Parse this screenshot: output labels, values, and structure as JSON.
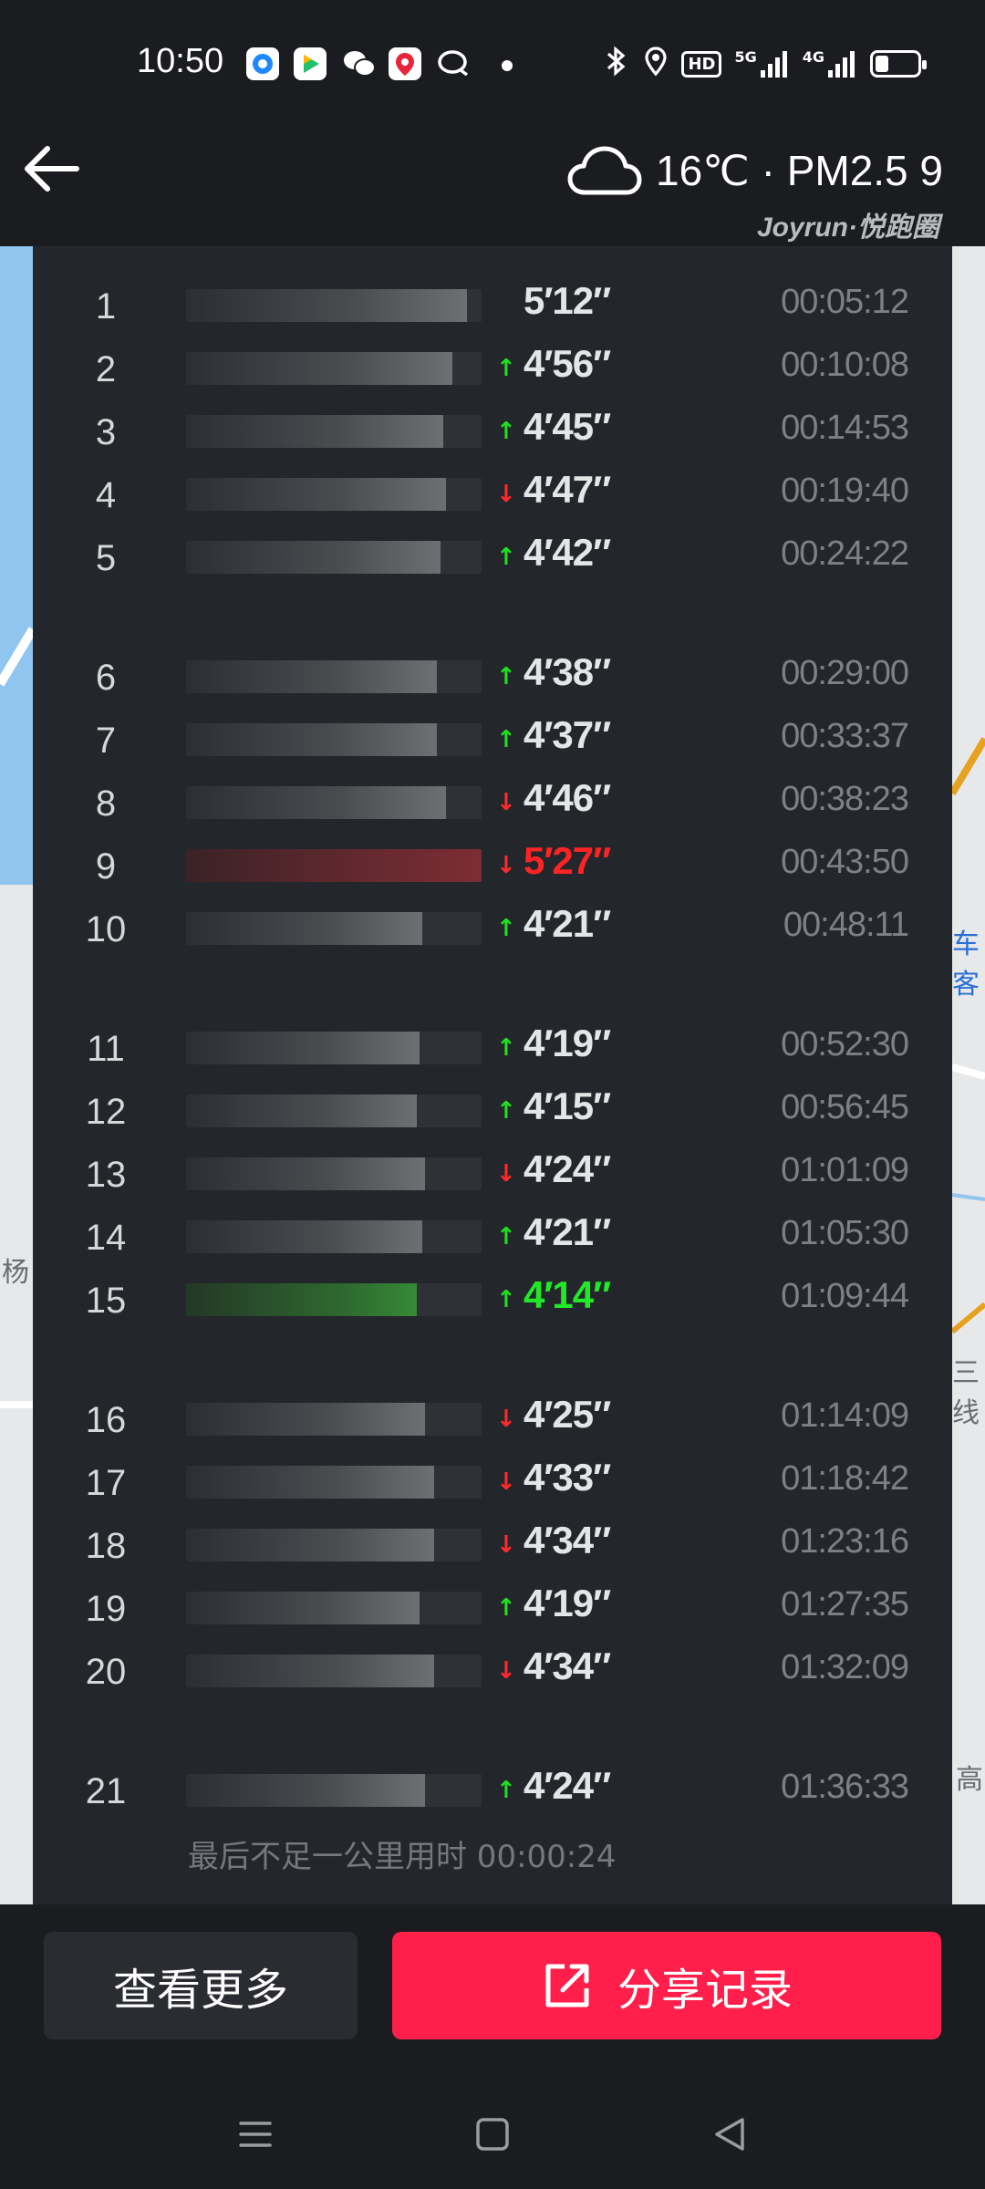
{
  "status_bar": {
    "time": "10:50",
    "notification_icons": [
      "qq-browser-icon",
      "video-player-icon",
      "wechat-icon",
      "maps-pin-icon",
      "chat-bubble-icon"
    ],
    "system_icons": [
      "bluetooth-icon",
      "location-icon",
      "hd-icon",
      "signal-5g-icon",
      "signal-4g-icon",
      "battery-icon"
    ],
    "hd_label": "HD",
    "net_5g": "5G",
    "net_4g": "4G"
  },
  "header": {
    "weather": "16℃ · PM2.5 9",
    "brand": "Joyrun·悦跑圈"
  },
  "map": {
    "label_left": "杨",
    "label_right_1": "车客",
    "label_right_2": "三线",
    "label_right_3": "高"
  },
  "colors": {
    "up": "#21e021",
    "down": "#ff2a2a",
    "slow_pace": "#ff2424",
    "fast_pace": "#22e82a",
    "share_button": "#ff1f4a"
  },
  "splits": [
    {
      "km": "1",
      "pace": "5′12″",
      "cum": "00:05:12",
      "trend": "none",
      "bar": 0.95,
      "highlight": "none"
    },
    {
      "km": "2",
      "pace": "4′56″",
      "cum": "00:10:08",
      "trend": "up",
      "bar": 0.9,
      "highlight": "none"
    },
    {
      "km": "3",
      "pace": "4′45″",
      "cum": "00:14:53",
      "trend": "up",
      "bar": 0.87,
      "highlight": "none"
    },
    {
      "km": "4",
      "pace": "4′47″",
      "cum": "00:19:40",
      "trend": "down",
      "bar": 0.88,
      "highlight": "none"
    },
    {
      "km": "5",
      "pace": "4′42″",
      "cum": "00:24:22",
      "trend": "up",
      "bar": 0.86,
      "highlight": "none"
    },
    {
      "km": "6",
      "pace": "4′38″",
      "cum": "00:29:00",
      "trend": "up",
      "bar": 0.85,
      "highlight": "none"
    },
    {
      "km": "7",
      "pace": "4′37″",
      "cum": "00:33:37",
      "trend": "up",
      "bar": 0.85,
      "highlight": "none"
    },
    {
      "km": "8",
      "pace": "4′46″",
      "cum": "00:38:23",
      "trend": "down",
      "bar": 0.88,
      "highlight": "none"
    },
    {
      "km": "9",
      "pace": "5′27″",
      "cum": "00:43:50",
      "trend": "down",
      "bar": 1.0,
      "highlight": "slow"
    },
    {
      "km": "10",
      "pace": "4′21″",
      "cum": "00:48:11",
      "trend": "up",
      "bar": 0.8,
      "highlight": "none"
    },
    {
      "km": "11",
      "pace": "4′19″",
      "cum": "00:52:30",
      "trend": "up",
      "bar": 0.79,
      "highlight": "none"
    },
    {
      "km": "12",
      "pace": "4′15″",
      "cum": "00:56:45",
      "trend": "up",
      "bar": 0.78,
      "highlight": "none"
    },
    {
      "km": "13",
      "pace": "4′24″",
      "cum": "01:01:09",
      "trend": "down",
      "bar": 0.81,
      "highlight": "none"
    },
    {
      "km": "14",
      "pace": "4′21″",
      "cum": "01:05:30",
      "trend": "up",
      "bar": 0.8,
      "highlight": "none"
    },
    {
      "km": "15",
      "pace": "4′14″",
      "cum": "01:09:44",
      "trend": "up",
      "bar": 0.78,
      "highlight": "fast"
    },
    {
      "km": "16",
      "pace": "4′25″",
      "cum": "01:14:09",
      "trend": "down",
      "bar": 0.81,
      "highlight": "none"
    },
    {
      "km": "17",
      "pace": "4′33″",
      "cum": "01:18:42",
      "trend": "down",
      "bar": 0.84,
      "highlight": "none"
    },
    {
      "km": "18",
      "pace": "4′34″",
      "cum": "01:23:16",
      "trend": "down",
      "bar": 0.84,
      "highlight": "none"
    },
    {
      "km": "19",
      "pace": "4′19″",
      "cum": "01:27:35",
      "trend": "up",
      "bar": 0.79,
      "highlight": "none"
    },
    {
      "km": "20",
      "pace": "4′34″",
      "cum": "01:32:09",
      "trend": "down",
      "bar": 0.84,
      "highlight": "none"
    },
    {
      "km": "21",
      "pace": "4′24″",
      "cum": "01:36:33",
      "trend": "up",
      "bar": 0.81,
      "highlight": "none"
    }
  ],
  "remainder_text": "最后不足一公里用时 00:00:24",
  "buttons": {
    "more": "查看更多",
    "share": "分享记录"
  },
  "nav": {
    "items": [
      "menu-icon",
      "home-icon",
      "back-icon"
    ]
  }
}
